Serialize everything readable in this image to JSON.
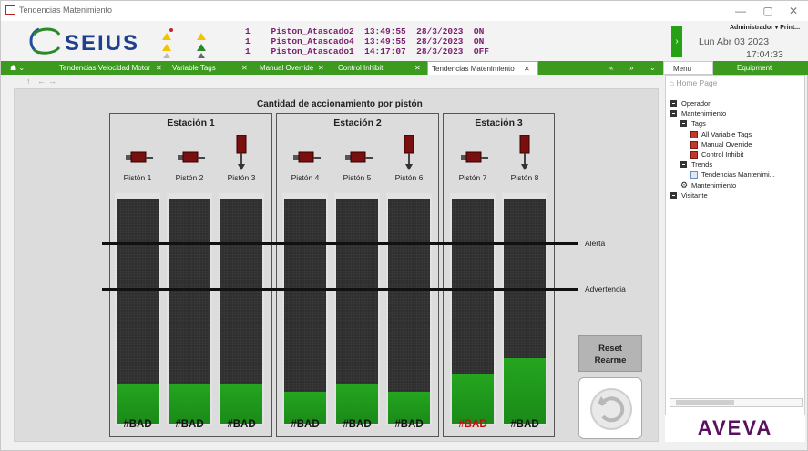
{
  "window": {
    "title": "Tendencias Matenimiento",
    "controls": {
      "minimize": "—",
      "maximize": "▢",
      "close": "✕"
    }
  },
  "header": {
    "logo_text": "SEIUS",
    "alarms": [
      {
        "count": "1",
        "tag": "Piston_Atascado2",
        "time": "13:49:55",
        "date": "28/3/2023",
        "state": "ON"
      },
      {
        "count": "1",
        "tag": "Piston_Atascado4",
        "time": "13:49:55",
        "date": "28/3/2023",
        "state": "ON"
      },
      {
        "count": "1",
        "tag": "Piston_Atascado1",
        "time": "14:17:07",
        "date": "28/3/2023",
        "state": "OFF"
      }
    ],
    "alarm_nav": "›",
    "user": "Administrador ▾   Print...",
    "date": "Lun Abr 03 2023",
    "time": "17:04:33"
  },
  "tabs": [
    {
      "label": "Tendencias Velocidad Motor",
      "close": "✕"
    },
    {
      "label": "Variable Tags",
      "close": "✕"
    },
    {
      "label": "Manual Override",
      "close": "✕"
    },
    {
      "label": "Control Inhibit",
      "close": "✕"
    },
    {
      "label": "Tendencias Matenimiento",
      "close": "✕",
      "active": true
    }
  ],
  "tab_controls": {
    "prev": "«",
    "next": "»",
    "menu": "⌄",
    "home": "☗ ⌄"
  },
  "nav": {
    "back": "↑",
    "prev": "←",
    "next": "→"
  },
  "panel_tabs": {
    "menu": "Menu",
    "equipment": "Equipment"
  },
  "chart_data": {
    "type": "bar",
    "title": "Cantidad de accionamiento por pistón",
    "stations": [
      {
        "name": "Estación 1",
        "pistons": [
          "Pistón 1",
          "Pistón 2",
          "Pistón 3"
        ]
      },
      {
        "name": "Estación 2",
        "pistons": [
          "Pistón 4",
          "Pistón 5",
          "Pistón 6"
        ]
      },
      {
        "name": "Estación 3",
        "pistons": [
          "Pistón 7",
          "Pistón 8"
        ]
      }
    ],
    "categories": [
      "Pistón 1",
      "Pistón 2",
      "Pistón 3",
      "Pistón 4",
      "Pistón 5",
      "Pistón 6",
      "Pistón 7",
      "Pistón 8"
    ],
    "values": [
      0.18,
      0.18,
      0.18,
      0.14,
      0.18,
      0.14,
      0.22,
      0.29
    ],
    "value_labels": [
      "#BAD",
      "#BAD",
      "#BAD",
      "#BAD",
      "#BAD",
      "#BAD",
      "#BAD",
      "#BAD"
    ],
    "ylim": [
      0,
      1
    ],
    "thresholds": [
      {
        "name": "Alerta",
        "value": 0.8
      },
      {
        "name": "Advertencia",
        "value": 0.61
      }
    ],
    "colors": {
      "fill": "#1e8a1e",
      "empty": "#2f2f2f",
      "bad_highlight": "#b11111"
    }
  },
  "reset_button": {
    "line1": "Reset",
    "line2": "Rearme"
  },
  "sidebar": {
    "home": "Home Page",
    "tree": [
      {
        "label": "Operador",
        "level": 0,
        "kind": "plus"
      },
      {
        "label": "Mantenimiento",
        "level": 0,
        "kind": "minus"
      },
      {
        "label": "Tags",
        "level": 1,
        "kind": "minus"
      },
      {
        "label": "All Variable Tags",
        "level": 2,
        "kind": "tag"
      },
      {
        "label": "Manual Override",
        "level": 2,
        "kind": "tag"
      },
      {
        "label": "Control Inhibit",
        "level": 2,
        "kind": "tag"
      },
      {
        "label": "Trends",
        "level": 1,
        "kind": "minus"
      },
      {
        "label": "Tendencias Mantenimi...",
        "level": 2,
        "kind": "trend"
      },
      {
        "label": "Mantenimiento",
        "level": 1,
        "kind": "gear"
      },
      {
        "label": "Visitante",
        "level": 0,
        "kind": "plus"
      }
    ],
    "brand": "AVEVA"
  }
}
